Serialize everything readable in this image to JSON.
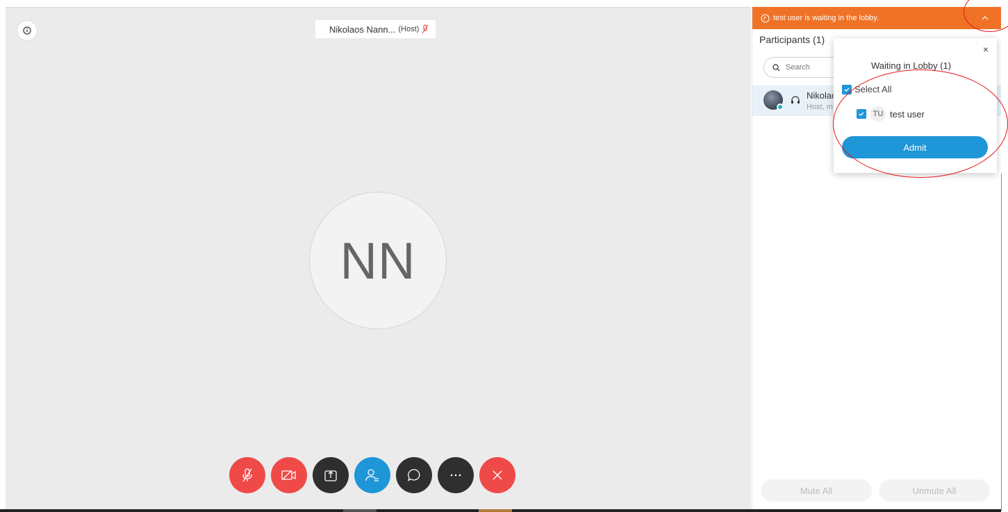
{
  "video": {
    "name_tag": "Nikolaos Nann...",
    "host_label": "(Host)",
    "avatar_initials": "NN"
  },
  "controls": [
    {
      "name": "mute-button",
      "icon": "mic-off-icon",
      "color": "#ef4a48"
    },
    {
      "name": "video-button",
      "icon": "video-off-icon",
      "color": "#ef4a48"
    },
    {
      "name": "share-button",
      "icon": "share-icon",
      "color": "#2f2f30"
    },
    {
      "name": "participants-button",
      "icon": "participants-icon",
      "color": "#1e96d8"
    },
    {
      "name": "chat-button",
      "icon": "chat-icon",
      "color": "#2f2f30"
    },
    {
      "name": "more-button",
      "icon": "more-icon",
      "color": "#2f2f30"
    },
    {
      "name": "leave-button",
      "icon": "close-icon",
      "color": "#ef4a48"
    }
  ],
  "panel": {
    "banner_text": "test user is waiting in the lobby.",
    "banner_color": "#ef7226",
    "title": "Participants (1)",
    "search_placeholder": "Search",
    "participant": {
      "name": "Nikolac",
      "role": "Host, m"
    },
    "mute_all": "Mute All",
    "unmute_all": "Unmute All"
  },
  "lobby": {
    "title": "Waiting in Lobby (1)",
    "close": "×",
    "select_all": "Select All",
    "user_initials": "TU",
    "user_name": "test user",
    "admit": "Admit",
    "accent": "#1e96d8"
  }
}
